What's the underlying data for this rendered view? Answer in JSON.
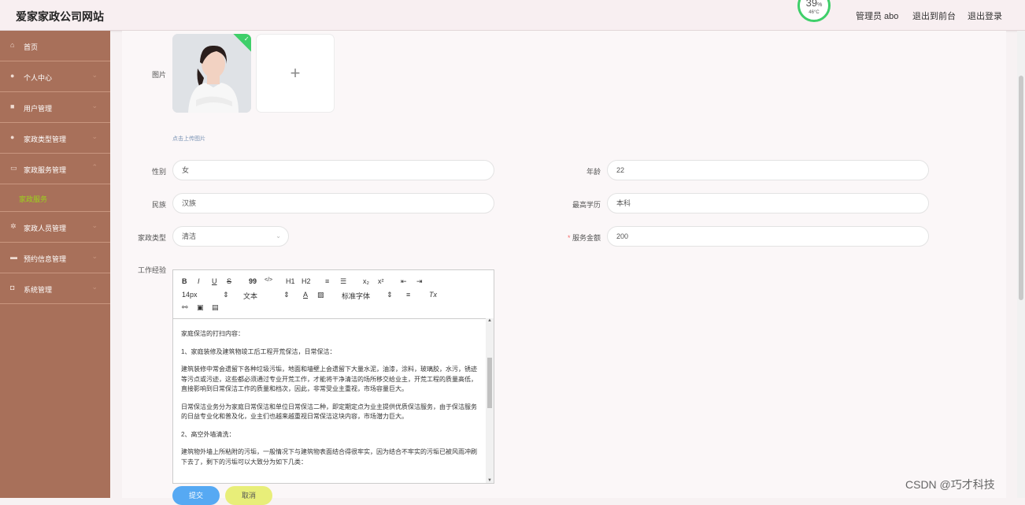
{
  "header": {
    "title": "爱家家政公司网站",
    "gauge_percent": "39",
    "gauge_percent_unit": "%",
    "gauge_temp": "46°C",
    "admin": "管理员 abo",
    "back_front": "退出到前台",
    "logout": "退出登录"
  },
  "sidebar": {
    "items": [
      {
        "label": "首页",
        "icon": "home-icon"
      },
      {
        "label": "个人中心",
        "icon": "user-icon"
      },
      {
        "label": "用户管理",
        "icon": "briefcase-icon"
      },
      {
        "label": "家政类型管理",
        "icon": "user-icon"
      },
      {
        "label": "家政服务管理",
        "icon": "card-icon"
      },
      {
        "label": "家政人员管理",
        "icon": "gear-icon"
      },
      {
        "label": "预约信息管理",
        "icon": "monitor-icon"
      },
      {
        "label": "系统管理",
        "icon": "database-icon"
      }
    ],
    "submenu_active": "家政服务"
  },
  "form": {
    "picture_label": "图片",
    "upload_hint": "点击上传图片",
    "add_symbol": "+",
    "gender_label": "性别",
    "gender_value": "女",
    "age_label": "年龄",
    "age_value": "22",
    "ethnicity_label": "民族",
    "ethnicity_value": "汉族",
    "education_label": "最高学历",
    "education_value": "本科",
    "type_label": "家政类型",
    "type_value": "清洁",
    "amount_required": "*",
    "amount_label": "服务金额",
    "amount_value": "200",
    "experience_label": "工作经验"
  },
  "editor": {
    "toolbar": {
      "bold": "B",
      "italic": "I",
      "underline": "U",
      "strike": "S",
      "quote": "99",
      "code": "</>",
      "h1": "H1",
      "h2": "H2",
      "sub": "x₂",
      "sup": "x²",
      "size": "14px",
      "format": "文本",
      "font": "标准字体",
      "clear": "Tx"
    },
    "paragraphs": [
      "家庭保洁的打扫内容：",
      "1、家庭装修及建筑物竣工后工程开荒保洁，日常保洁：",
      "建筑装修中常会遗留下各种垃圾污垢，地面和墙壁上会遗留下大量水泥，油漆，涂料，玻璃胶，水污，锈迹等污点或污迹，这些都必须通过专业开荒工作，才能将干净清洁的场所移交给业主，开荒工程的质量高低，直接影响到日常保洁工作的质量和档次，因此，非常受业主重视，市场容量巨大。",
      "日常保洁业务分为家庭日常保洁和单位日常保洁二种，即定期定点为业主提供优质保洁服务，由于保洁服务的日益专业化和普及化，业主们也越来越重视日常保洁这块内容，市场潜力巨大。",
      "2、高空外墙清洗：",
      "建筑物外墙上所粘附的污垢，一般情况下与建筑物表面结合得很牢实，因为结合不牢实的污垢已被风雨冲刷下去了，剩下的污垢可以大致分为如下几类："
    ]
  },
  "buttons": {
    "save": "提交",
    "cancel": "取消"
  },
  "watermark": "CSDN @巧才科技",
  "colors": {
    "sidebar_bg": "#a8705a",
    "submenu_active": "#9bd31b",
    "save_button": "#56a9f3",
    "cancel_button": "#e8ee79",
    "gauge_ring": "#3fcf6a"
  }
}
